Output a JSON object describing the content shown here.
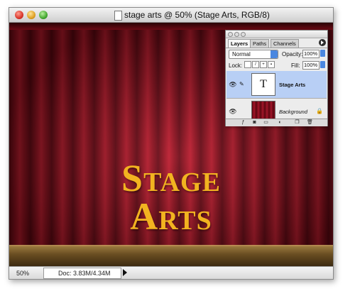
{
  "window": {
    "title": "stage arts @ 50% (Stage Arts, RGB/8)"
  },
  "canvas": {
    "headline_line1": "Stage",
    "headline_line2": "Arts",
    "text_color": "#f2b320",
    "curtain_color": "#93111f"
  },
  "statusbar": {
    "zoom": "50%",
    "doc_info": "Doc: 3.83M/4.34M"
  },
  "layers_panel": {
    "tabs": [
      "Layers",
      "Paths",
      "Channels"
    ],
    "active_tab": "Layers",
    "blend_mode": "Normal",
    "opacity_label": "Opacity:",
    "opacity_value": "100%",
    "lock_label": "Lock:",
    "fill_label": "Fill:",
    "fill_value": "100%",
    "layers": [
      {
        "name": "Stage Arts",
        "thumb": "T",
        "selected": true
      },
      {
        "name": "Background",
        "thumb": "",
        "selected": false,
        "locked": true
      }
    ]
  }
}
